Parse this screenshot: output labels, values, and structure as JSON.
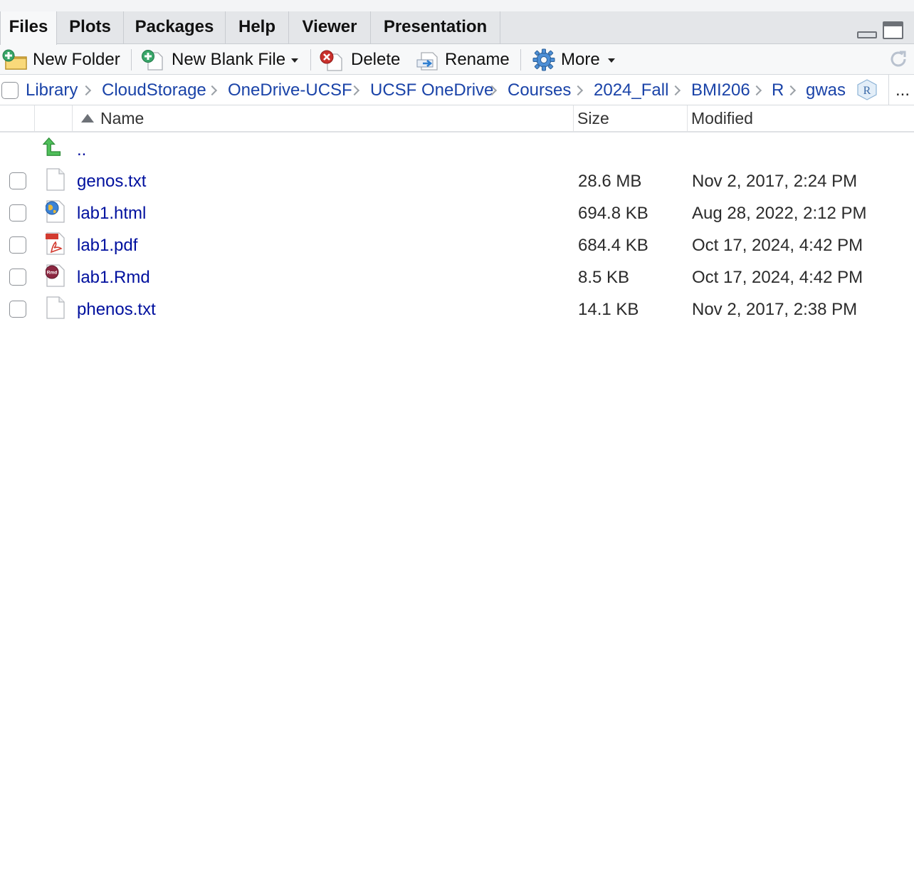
{
  "tabs": [
    {
      "label": "Files",
      "active": true
    },
    {
      "label": "Plots",
      "active": false
    },
    {
      "label": "Packages",
      "active": false
    },
    {
      "label": "Help",
      "active": false
    },
    {
      "label": "Viewer",
      "active": false
    },
    {
      "label": "Presentation",
      "active": false
    }
  ],
  "toolbar": {
    "new_folder": "New Folder",
    "new_blank_file": "New Blank File",
    "delete": "Delete",
    "rename": "Rename",
    "more": "More"
  },
  "breadcrumb": {
    "items": [
      "Library",
      "CloudStorage",
      "OneDrive-UCSF",
      "UCSF OneDrive",
      "Courses",
      "2024_Fall",
      "BMI206",
      "R",
      "gwas"
    ],
    "overflow": "..."
  },
  "columns": {
    "name": "Name",
    "size": "Size",
    "modified": "Modified",
    "sort": "name ascending"
  },
  "parent_dir": "..",
  "files": [
    {
      "name": "genos.txt",
      "size": "28.6 MB",
      "modified": "Nov 2, 2017, 2:24 PM",
      "icon": "text-file-icon"
    },
    {
      "name": "lab1.html",
      "size": "694.8 KB",
      "modified": "Aug 28, 2022, 2:12 PM",
      "icon": "html-file-icon"
    },
    {
      "name": "lab1.pdf",
      "size": "684.4 KB",
      "modified": "Oct 17, 2024, 4:42 PM",
      "icon": "pdf-file-icon"
    },
    {
      "name": "lab1.Rmd",
      "size": "8.5 KB",
      "modified": "Oct 17, 2024, 4:42 PM",
      "icon": "rmd-file-icon"
    },
    {
      "name": "phenos.txt",
      "size": "14.1 KB",
      "modified": "Nov 2, 2017, 2:38 PM",
      "icon": "text-file-icon"
    }
  ],
  "colors": {
    "link": "#00109e",
    "crumb": "#1a43a8",
    "tabbar": "#e4e6e9"
  }
}
